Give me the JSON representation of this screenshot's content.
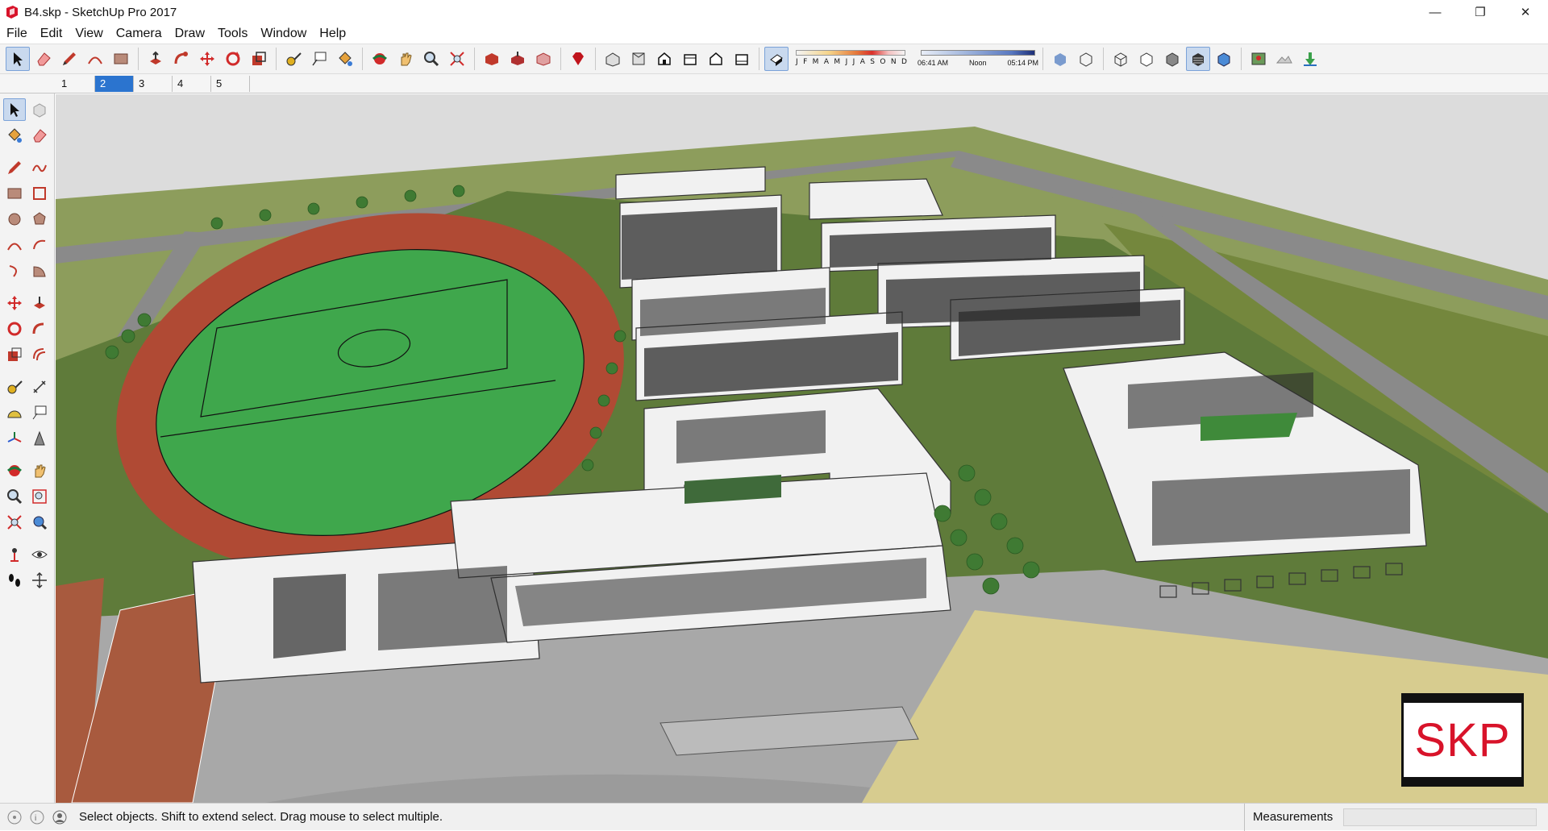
{
  "window": {
    "title": "B4.skp - SketchUp Pro 2017",
    "minimize": "—",
    "restore": "❐",
    "close": "✕"
  },
  "menu": [
    "File",
    "Edit",
    "View",
    "Camera",
    "Draw",
    "Tools",
    "Window",
    "Help"
  ],
  "shadows": {
    "months": [
      "J",
      "F",
      "M",
      "A",
      "M",
      "J",
      "J",
      "A",
      "S",
      "O",
      "N",
      "D"
    ],
    "time_start": "06:41 AM",
    "time_mid": "Noon",
    "time_end": "05:14 PM"
  },
  "scene_tabs": [
    {
      "label": "1",
      "active": false
    },
    {
      "label": "2",
      "active": true
    },
    {
      "label": "3",
      "active": false
    },
    {
      "label": "4",
      "active": false
    },
    {
      "label": "5",
      "active": false
    }
  ],
  "viewport": {
    "badge": "SKP"
  },
  "status": {
    "message": "Select objects. Shift to extend select. Drag mouse to select multiple.",
    "measurements_label": "Measurements",
    "measurements_value": ""
  },
  "colors": {
    "accent": "#2b74cf",
    "grass": "#6f8a3e",
    "field": "#3fa74c",
    "track": "#b04a34",
    "road": "#9b9b9b",
    "badge_text": "#d8132a"
  }
}
